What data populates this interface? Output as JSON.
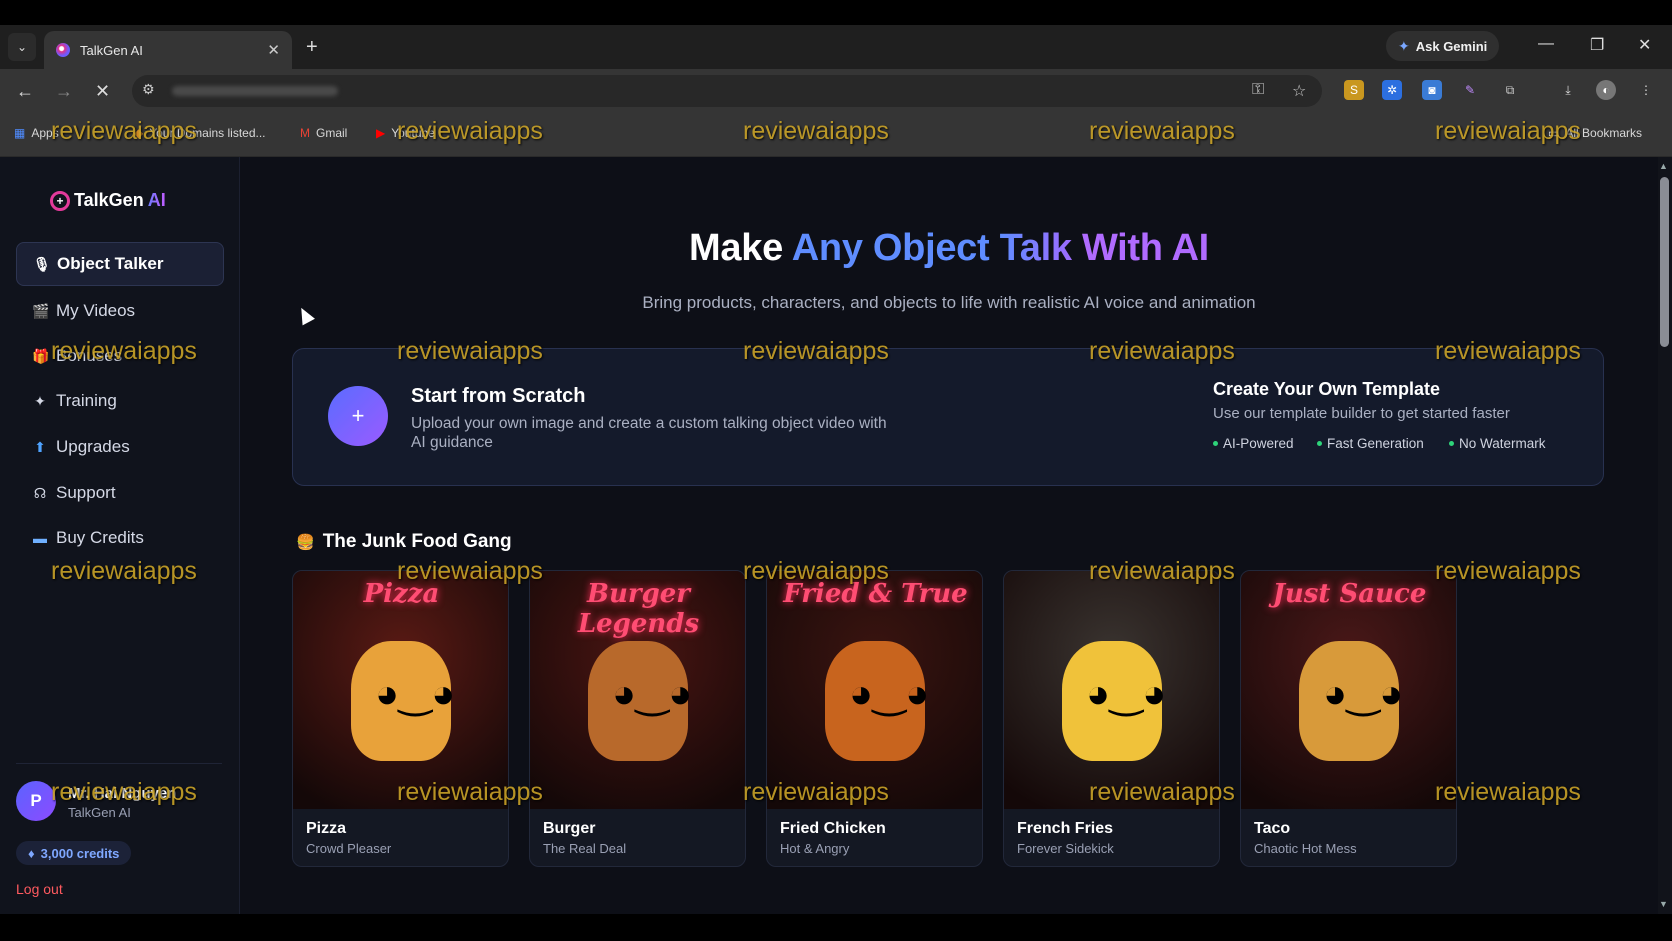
{
  "browser": {
    "tab_title": "TalkGen AI",
    "gemini_label": "Ask Gemini",
    "bookmarks": [
      "Apps",
      "Your Domains listed...",
      "Gmail",
      "Youtube",
      "All Bookmarks"
    ]
  },
  "sidebar": {
    "logo_text": "TalkGen",
    "logo_ai": "AI",
    "items": [
      {
        "label": "Object Talker",
        "icon": "microphone-icon"
      },
      {
        "label": "My Videos",
        "icon": "clapper-icon"
      },
      {
        "label": "Bonuses",
        "icon": "gift-icon"
      },
      {
        "label": "Training",
        "icon": "training-icon"
      },
      {
        "label": "Upgrades",
        "icon": "upgrade-icon"
      },
      {
        "label": "Support",
        "icon": "headset-icon"
      },
      {
        "label": "Buy Credits",
        "icon": "card-icon"
      }
    ],
    "profile": {
      "initial": "P",
      "name": "Mr. Hai Nguyen",
      "subtitle": "TalkGen AI",
      "credits": "3,000 credits",
      "logout": "Log out"
    }
  },
  "hero": {
    "title_make": "Make",
    "title_any_object": "Any Object",
    "title_talk": "Talk",
    "title_with_ai": "With AI",
    "subtitle": "Bring products, characters, and objects to life with realistic AI voice and animation"
  },
  "scratch": {
    "plus": "+",
    "title": "Start from Scratch",
    "description": "Upload your own image and create a custom talking object video with AI guidance",
    "template_title": "Create Your Own Template",
    "template_desc": "Use our template builder to get started faster",
    "features": [
      "AI-Powered",
      "Fast Generation",
      "No Watermark"
    ]
  },
  "gallery": {
    "section_title": "The Junk Food Gang",
    "cards": [
      {
        "name": "Pizza",
        "subtitle": "Crowd Pleaser",
        "sign": "Pizza",
        "bg": "#5a1a14",
        "char": "#e8a23a"
      },
      {
        "name": "Burger",
        "subtitle": "The Real Deal",
        "sign": "Burger Legends",
        "bg": "#4a1512",
        "char": "#b8692b"
      },
      {
        "name": "Fried Chicken",
        "subtitle": "Hot & Angry",
        "sign": "Fried & True",
        "bg": "#3a1410",
        "char": "#c8641e"
      },
      {
        "name": "French Fries",
        "subtitle": "Forever Sidekick",
        "sign": "",
        "bg": "#3a3430",
        "char": "#f0c23a"
      },
      {
        "name": "Taco",
        "subtitle": "Chaotic Hot Mess",
        "sign": "Just Sauce",
        "bg": "#4a1818",
        "char": "#d89a3a"
      }
    ]
  },
  "watermark": "reviewaiapps"
}
